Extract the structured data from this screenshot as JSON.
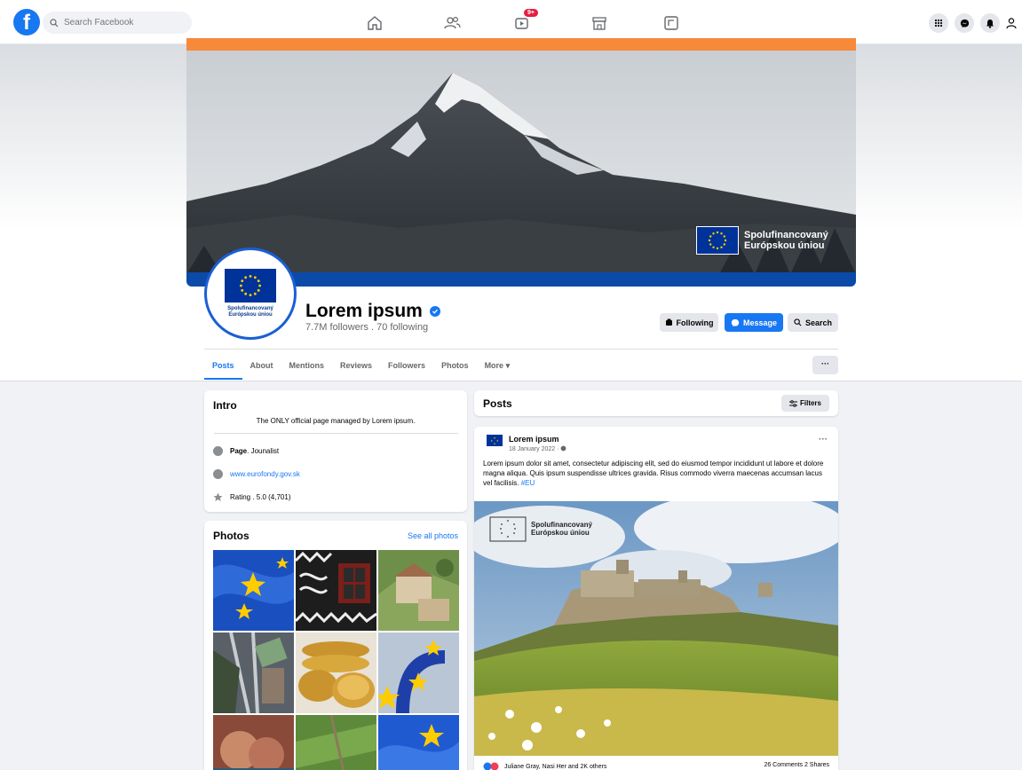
{
  "topbar": {
    "search_placeholder": "Search Facebook",
    "video_badge": "9+",
    "icons": [
      "home-icon",
      "friends-icon",
      "video-icon",
      "marketplace-icon",
      "gaming-icon",
      "menu-grid-icon",
      "messenger-icon",
      "bell-icon",
      "account-icon"
    ]
  },
  "cover": {
    "eu_text_line1": "Spolufinancovaný",
    "eu_text_line2": "Európskou úniou",
    "accent": "#f7893b",
    "band": "#0b4aa8"
  },
  "profile": {
    "avatar_line1": "Spolufinancovaný",
    "avatar_line2": "Európskou úniou",
    "name": "Lorem ipsum",
    "stats": "7.7M followers . 70 following"
  },
  "buttons": {
    "following": "Following",
    "message": "Message",
    "search": "Search",
    "more": "···"
  },
  "tabs": [
    "Posts",
    "About",
    "Mentions",
    "Reviews",
    "Followers",
    "Photos",
    "More ▾"
  ],
  "intro": {
    "title": "Intro",
    "text": "The ONLY official page managed by Lorem ipsum.",
    "page_type_label": "Page",
    "page_type": " . Jounalist",
    "website": "www.eurofondy.gov.sk",
    "rating": "Rating . 5.0 (4,701)"
  },
  "photos": {
    "title": "Photos",
    "see_all": "See all photos"
  },
  "posts": {
    "title": "Posts",
    "filters": "Filters",
    "author": "Lorem ipsum",
    "date": "18 January 2022 · ",
    "text": "Lorem ipsum dolor sit amet, consectetur adipiscing elit, sed do eiusmod tempor incididunt ut labore et dolore magna aliqua. Quis ipsum suspendisse ultrices gravida. Risus commodo viverra maecenas accumsan lacus vel facilisis. ",
    "hashtag": "#EU",
    "more": "···",
    "img_eu_line1": "Spolufinancovaný",
    "img_eu_line2": "Európskou úniou",
    "reactions": "Juliane Gray, Nasi Her and 2K others",
    "stats": "26 Comments  2 Shares"
  },
  "colors": {
    "facebook_blue": "#1877f2",
    "eu_blue": "#003399"
  }
}
